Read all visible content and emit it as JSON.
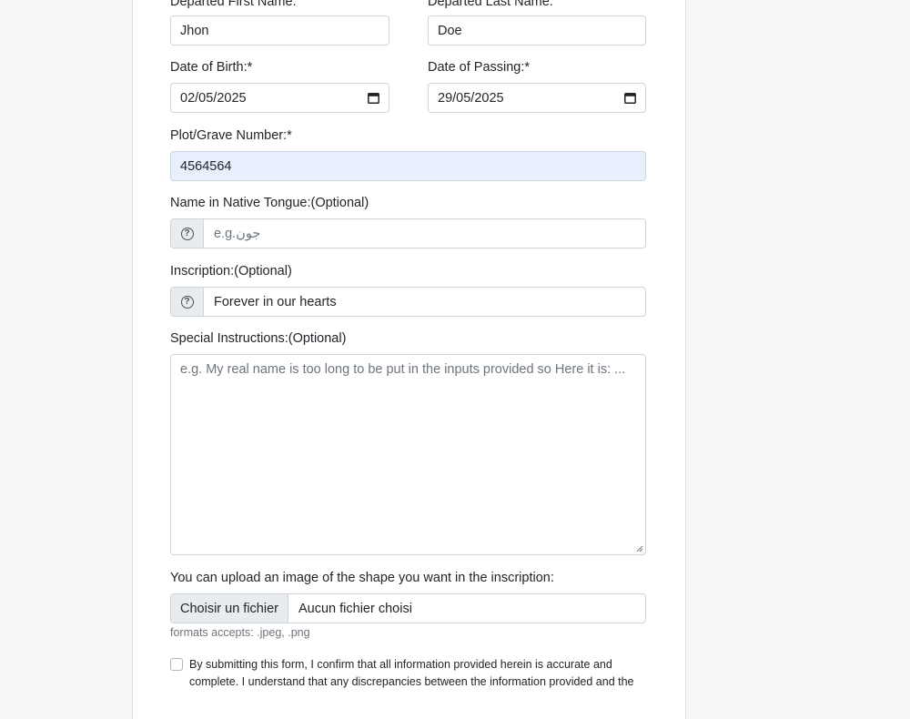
{
  "form": {
    "first_name": {
      "label": "Departed First Name:",
      "value": "Jhon"
    },
    "last_name": {
      "label": "Departed Last Name:",
      "value": "Doe"
    },
    "dob": {
      "label": "Date of Birth:*",
      "value": "02/05/2025"
    },
    "dop": {
      "label": "Date of Passing:*",
      "value": "29/05/2025"
    },
    "plot": {
      "label": "Plot/Grave Number:*",
      "value": "4564564"
    },
    "native_name": {
      "label": "Name in Native Tongue:(Optional)",
      "placeholder": "e.g.جون"
    },
    "inscription": {
      "label": "Inscription:(Optional)",
      "value": "Forever in our hearts"
    },
    "special": {
      "label": "Special Instructions:(Optional)",
      "placeholder": "e.g. My real name is too long to be put in the inputs provided so Here it is: ..."
    },
    "upload": {
      "label": "You can upload an image of the shape you want in the inscription:",
      "button": "Choisir un fichier",
      "status": "Aucun fichier choisi",
      "hint": "formats accepts: .jpeg, .png"
    },
    "terms": {
      "text": "By submitting this form, I confirm that all information provided herein is accurate and complete. I understand that any discrepancies between the information provided and the"
    },
    "help_icon_glyph": "?"
  }
}
